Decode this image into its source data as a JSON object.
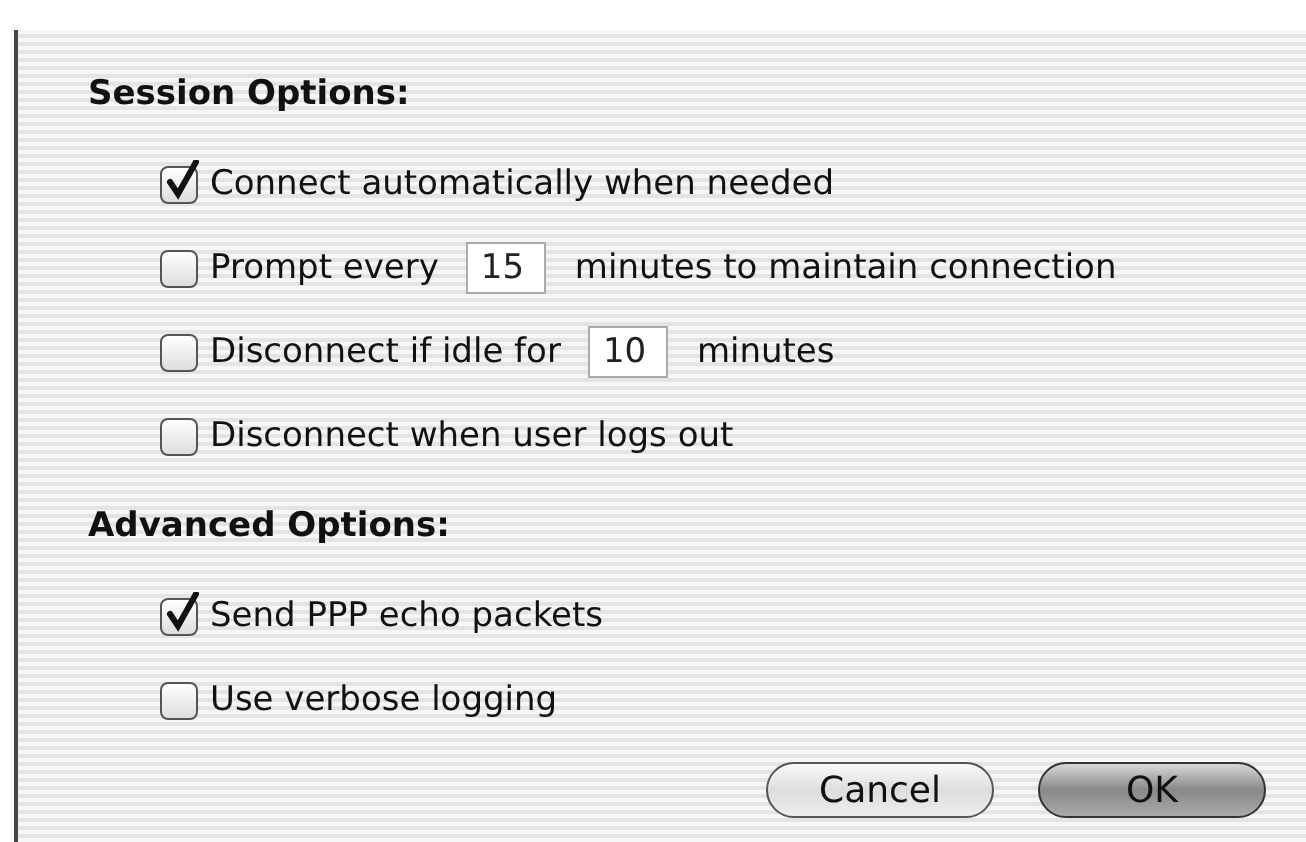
{
  "sections": [
    {
      "title": "Session Options:",
      "options": [
        {
          "kind": "plain",
          "label": "Connect automatically when needed",
          "checked": true
        },
        {
          "kind": "field",
          "label": "Prompt every",
          "value": "15",
          "suffix": "minutes to maintain connection",
          "checked": false
        },
        {
          "kind": "field",
          "label": "Disconnect if idle for",
          "value": "10",
          "suffix": "minutes",
          "checked": false
        },
        {
          "kind": "plain",
          "label": "Disconnect when user logs out",
          "checked": false
        }
      ]
    },
    {
      "title": "Advanced Options:",
      "options": [
        {
          "kind": "plain",
          "label": "Send PPP echo packets",
          "checked": true
        },
        {
          "kind": "plain",
          "label": "Use verbose logging",
          "checked": false
        }
      ]
    }
  ],
  "buttons": [
    {
      "label": "Cancel",
      "default": false
    },
    {
      "label": "OK",
      "default": true
    }
  ]
}
